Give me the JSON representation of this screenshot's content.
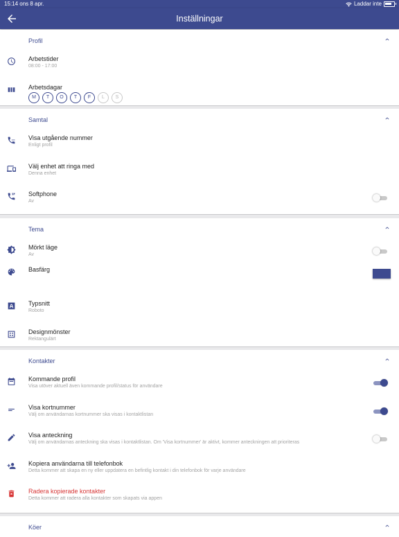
{
  "status_bar": {
    "time_date": "15:14  ons 8 apr.",
    "battery_label": "Laddar inte"
  },
  "app_bar": {
    "title": "Inställningar"
  },
  "colors": {
    "accent": "#3d4a8f",
    "danger": "#d73535"
  },
  "sections": {
    "profil": {
      "title": "Profil",
      "working_hours": {
        "label": "Arbetstider",
        "value": "08:00 - 17:00"
      },
      "working_days": {
        "label": "Arbetsdagar",
        "days": [
          {
            "label": "M",
            "active": true
          },
          {
            "label": "T",
            "active": true
          },
          {
            "label": "O",
            "active": true
          },
          {
            "label": "T",
            "active": true
          },
          {
            "label": "F",
            "active": true
          },
          {
            "label": "L",
            "active": false
          },
          {
            "label": "S",
            "active": false
          }
        ]
      }
    },
    "samtal": {
      "title": "Samtal",
      "outgoing_number": {
        "label": "Visa utgående nummer",
        "value": "Enligt profil"
      },
      "call_device": {
        "label": "Välj enhet att ringa med",
        "value": "Denna enhet"
      },
      "softphone": {
        "label": "Softphone",
        "value": "Av",
        "enabled": false
      }
    },
    "tema": {
      "title": "Tema",
      "dark_mode": {
        "label": "Mörkt läge",
        "value": "Av",
        "enabled": false
      },
      "base_color": {
        "label": "Basfärg",
        "color": "#3d4a8f"
      },
      "font": {
        "label": "Typsnitt",
        "value": "Roboto"
      },
      "pattern": {
        "label": "Designmönster",
        "value": "Rektangulärt"
      }
    },
    "kontakter": {
      "title": "Kontakter",
      "upcoming_profile": {
        "label": "Kommande profil",
        "value": "Visa utöver aktuell även kommande profil/status för användare",
        "enabled": true
      },
      "short_number": {
        "label": "Visa kortnummer",
        "value": "Välj om användarnas kortnummer ska visas i kontaktlistan",
        "enabled": true
      },
      "note": {
        "label": "Visa anteckning",
        "value": "Välj om användarnas anteckning ska visas i kontaktlistan. Om 'Visa kortnummer' är aktivt, kommer anteckningen att prioriteras",
        "enabled": false
      },
      "copy_users": {
        "label": "Kopiera användarna till telefonbok",
        "value": "Detta kommer att skapa en ny eller uppdatera en befintlig kontakt i din telefonbok för varje användare"
      },
      "delete_copied": {
        "label": "Radera kopierade kontakter",
        "value": "Detta kommer att radera alla kontakter som skapats via appen"
      }
    },
    "koer": {
      "title": "Köer"
    }
  }
}
